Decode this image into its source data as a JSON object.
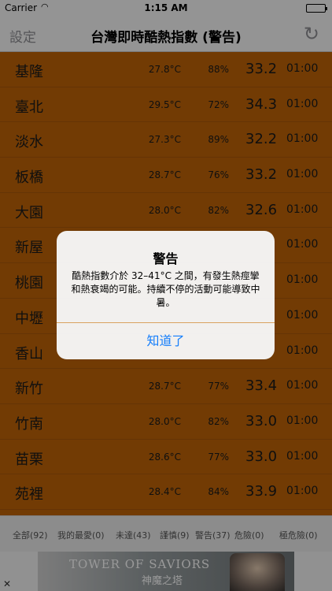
{
  "status_bar": {
    "carrier": "Carrier",
    "wifi": "wifi-icon",
    "time": "1:15 AM",
    "battery": "battery-icon"
  },
  "nav": {
    "settings_label": "設定",
    "title": "台灣即時酷熱指數 (警告)",
    "refresh": "refresh-icon"
  },
  "colors": {
    "list_background": "#bf6308",
    "alert_button": "#157efb"
  },
  "rows": [
    {
      "city": "基隆",
      "temp": "27.8°C",
      "humidity": "88%",
      "index": "33.2",
      "time": "01:00"
    },
    {
      "city": "臺北",
      "temp": "29.5°C",
      "humidity": "72%",
      "index": "34.3",
      "time": "01:00"
    },
    {
      "city": "淡水",
      "temp": "27.3°C",
      "humidity": "89%",
      "index": "32.2",
      "time": "01:00"
    },
    {
      "city": "板橋",
      "temp": "28.7°C",
      "humidity": "76%",
      "index": "33.2",
      "time": "01:00"
    },
    {
      "city": "大園",
      "temp": "28.0°C",
      "humidity": "82%",
      "index": "32.6",
      "time": "01:00"
    },
    {
      "city": "新屋",
      "temp": "",
      "humidity": "",
      "index": "",
      "time": "01:00"
    },
    {
      "city": "桃園",
      "temp": "",
      "humidity": "",
      "index": "",
      "time": "01:00"
    },
    {
      "city": "中壢",
      "temp": "",
      "humidity": "",
      "index": "",
      "time": "01:00"
    },
    {
      "city": "香山",
      "temp": "",
      "humidity": "",
      "index": "",
      "time": "01:00"
    },
    {
      "city": "新竹",
      "temp": "28.7°C",
      "humidity": "77%",
      "index": "33.4",
      "time": "01:00"
    },
    {
      "city": "竹南",
      "temp": "28.0°C",
      "humidity": "82%",
      "index": "33.0",
      "time": "01:00"
    },
    {
      "city": "苗栗",
      "temp": "28.6°C",
      "humidity": "77%",
      "index": "33.0",
      "time": "01:00"
    },
    {
      "city": "苑裡",
      "temp": "28.4°C",
      "humidity": "84%",
      "index": "33.9",
      "time": "01:00"
    }
  ],
  "alert": {
    "title": "警告",
    "message": "酷熱指數介於 32–41°C 之間，有發生熱痙攣和熱衰竭的可能。持續不停的活動可能導致中暑。",
    "button_label": "知道了"
  },
  "filters": [
    {
      "label": "全部(92)"
    },
    {
      "label": "我的最愛(0)"
    },
    {
      "label": "未達(43)"
    },
    {
      "label": "謹慎(9)"
    },
    {
      "label": "警告(37)"
    },
    {
      "label": "危險(0)"
    },
    {
      "label": "極危險(0)"
    }
  ],
  "ad": {
    "title": "TOWER OF SAVIORS",
    "subtitle": "神魔之塔",
    "close_label": "✕"
  }
}
